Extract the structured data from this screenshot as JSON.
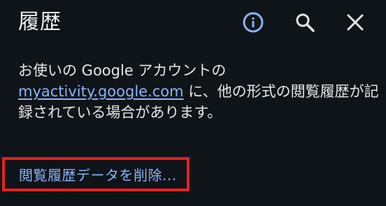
{
  "header": {
    "title": "履歴"
  },
  "icons": {
    "info": "info-icon",
    "search": "search-icon",
    "close": "close-icon",
    "accent": "#8ab4f8"
  },
  "description": {
    "line1": "お使いの Google アカウントの",
    "link": "myactivity.google.com",
    "line2_suffix": " に、他の形式の閲覧履歴が記",
    "line3": "録されている場合があります。"
  },
  "actions": {
    "delete_browsing_data": "閲覧履歴データを削除..."
  },
  "colors": {
    "background": "#0f1419",
    "link": "#8ab4f8",
    "highlight_border": "#e8201f"
  }
}
